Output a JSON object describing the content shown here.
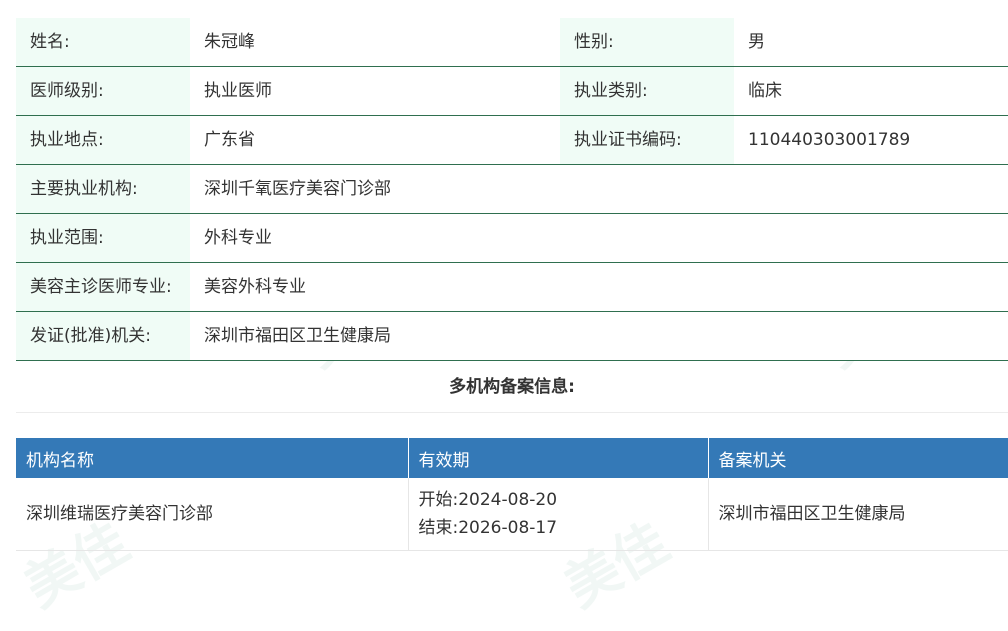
{
  "doctor_info": {
    "rows": [
      {
        "label": "姓名:",
        "value": "朱冠峰",
        "label2": "性别:",
        "value2": "男"
      },
      {
        "label": "医师级别:",
        "value": "执业医师",
        "label2": "执业类别:",
        "value2": "临床"
      },
      {
        "label": "执业地点:",
        "value": "广东省",
        "label2": "执业证书编码:",
        "value2": "110440303001789"
      },
      {
        "label": "主要执业机构:",
        "value": "深圳千氧医疗美容门诊部"
      },
      {
        "label": "执业范围:",
        "value": "外科专业"
      },
      {
        "label": "美容主诊医师专业:",
        "value": "美容外科专业"
      },
      {
        "label": "发证(批准)机关:",
        "value": "深圳市福田区卫生健康局"
      }
    ]
  },
  "multi_record": {
    "title": "多机构备案信息:",
    "headers": [
      "机构名称",
      "有效期",
      "备案机关"
    ],
    "rows": [
      {
        "institution": "深圳维瑞医疗美容门诊部",
        "start": "开始:2024-08-20",
        "end": "结束:2026-08-17",
        "authority": "深圳市福田区卫生健康局"
      }
    ]
  },
  "watermark": {
    "text": "美佳",
    "color": "#c8e1d7"
  }
}
